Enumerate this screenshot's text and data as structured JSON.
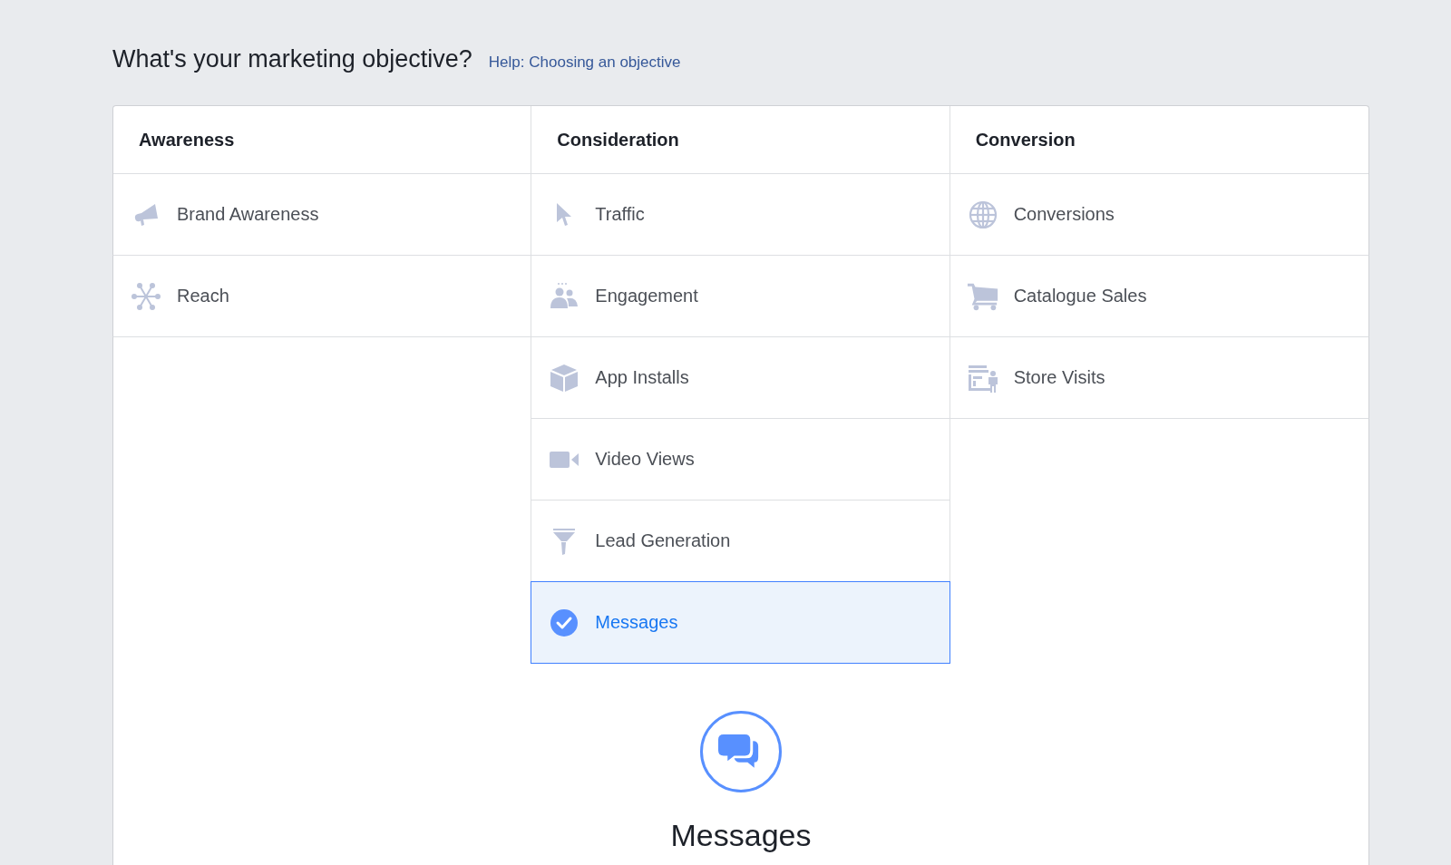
{
  "heading": {
    "title": "What's your marketing objective?",
    "help_link": "Help: Choosing an objective"
  },
  "columns": [
    {
      "title": "Awareness",
      "items": [
        {
          "label": "Brand Awareness",
          "kind": "megaphone",
          "selected": false
        },
        {
          "label": "Reach",
          "kind": "network",
          "selected": false
        }
      ]
    },
    {
      "title": "Consideration",
      "items": [
        {
          "label": "Traffic",
          "kind": "cursor",
          "selected": false
        },
        {
          "label": "Engagement",
          "kind": "people",
          "selected": false
        },
        {
          "label": "App Installs",
          "kind": "box",
          "selected": false
        },
        {
          "label": "Video Views",
          "kind": "video",
          "selected": false
        },
        {
          "label": "Lead Generation",
          "kind": "funnel",
          "selected": false
        },
        {
          "label": "Messages",
          "selected": true
        }
      ]
    },
    {
      "title": "Conversion",
      "items": [
        {
          "label": "Conversions",
          "kind": "globe",
          "selected": false
        },
        {
          "label": "Catalogue Sales",
          "kind": "cart",
          "selected": false
        },
        {
          "label": "Store Visits",
          "kind": "store",
          "selected": false
        }
      ]
    }
  ],
  "detail": {
    "title": "Messages",
    "kind": "chat"
  }
}
